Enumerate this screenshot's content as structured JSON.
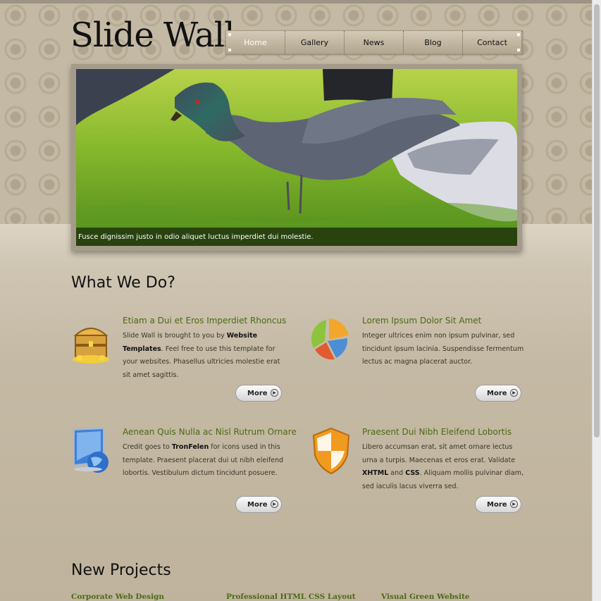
{
  "header": {
    "logo": "Slide Wall",
    "nav": [
      {
        "label": "Home",
        "active": true
      },
      {
        "label": "Gallery",
        "active": false
      },
      {
        "label": "News",
        "active": false
      },
      {
        "label": "Blog",
        "active": false
      },
      {
        "label": "Contact",
        "active": false
      }
    ]
  },
  "slider": {
    "caption": "Fusce dignissim justo in odio aliquet luctus imperdiet dui molestie."
  },
  "what_we_do": {
    "title": "What We Do?",
    "features": [
      {
        "title": "Etiam a Dui et Eros Imperdiet Rhoncus",
        "body_1": "Slide Wall is brought to you by ",
        "body_strong": "Website Templates",
        "body_2": ". Feel free to use this template for your websites. Phasellus ultricies molestie erat sit amet sagittis.",
        "icon": "treasure-chest-icon",
        "more": "More"
      },
      {
        "title": "Lorem Ipsum Dolor Sit Amet",
        "body": "Integer ultrices enim non ipsum pulvinar, sed tincidunt ipsum lacinia. Suspendisse fermentum lectus ac magna placerat auctor.",
        "icon": "pie-chart-icon",
        "more": "More"
      },
      {
        "title": "Aenean Quis Nulla ac Nisl Rutrum Ornare",
        "body_1": "Credit goes to ",
        "body_strong": "TronFelen",
        "body_2": " for icons used in this template. Praesent placerat dui ut nibh eleifend lobortis. Vestibulum dictum tincidunt posuere.",
        "icon": "globe-computer-icon",
        "more": "More"
      },
      {
        "title": "Praesent Dui Nibh Eleifend Lobortis",
        "body_1": "Libero accumsan erat, sit amet ornare lectus urna a turpis. Maecenas et eros erat. Validate ",
        "body_strong": "XHTML",
        "body_mid": " and ",
        "body_strong_2": "CSS",
        "body_2": ". Aliquam mollis pulvinar diam, sed iaculis lacus viverra sed.",
        "icon": "shield-icon",
        "more": "More"
      }
    ]
  },
  "new_projects": {
    "title": "New Projects",
    "links": [
      "Corporate Web Design",
      "Professional HTML CSS Layout",
      "Visual Green Website"
    ]
  },
  "colors": {
    "accent_green": "#4a6a12",
    "background": "#c4b9a4"
  }
}
